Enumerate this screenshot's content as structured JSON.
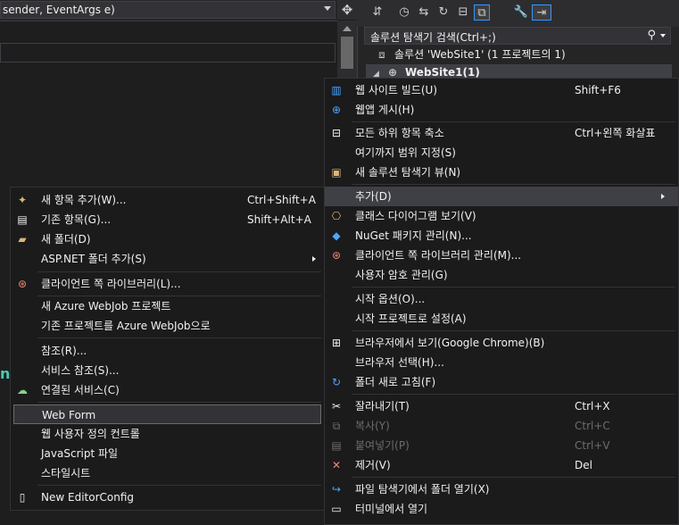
{
  "editor": {
    "method_combo": "sender, EventArgs e)",
    "split_icon": "✥",
    "code_fragment": "n"
  },
  "solution_explorer": {
    "search_placeholder": "솔루션 탐색기 검색(Ctrl+;)",
    "solution_label": "솔루션 'WebSite1' (1 프로젝트의 1)",
    "project_label": "WebSite1(1)"
  },
  "context_menu": {
    "items": [
      {
        "label": "웹 사이트 빌드(U)",
        "shortcut": "Shift+F6",
        "icon": "build-icon"
      },
      {
        "label": "웹앱 게시(H)",
        "shortcut": "",
        "icon": "publish-globe-icon"
      },
      {
        "label": "모든 하위 항목 축소",
        "shortcut": "Ctrl+왼쪽 화살표",
        "icon": "collapse-icon"
      },
      {
        "label": "여기까지 범위 지정(S)",
        "shortcut": "",
        "icon": ""
      },
      {
        "label": "새 솔루션 탐색기 뷰(N)",
        "shortcut": "",
        "icon": "new-view-icon"
      },
      {
        "label": "추가(D)",
        "shortcut": "",
        "icon": "",
        "submenu": true
      },
      {
        "label": "클래스 다이어그램 보기(V)",
        "shortcut": "",
        "icon": "class-diagram-icon"
      },
      {
        "label": "NuGet 패키지 관리(N)...",
        "shortcut": "",
        "icon": "nuget-icon"
      },
      {
        "label": "클라이언트 쪽 라이브러리 관리(M)...",
        "shortcut": "",
        "icon": "library-icon"
      },
      {
        "label": "사용자 암호 관리(G)",
        "shortcut": "",
        "icon": ""
      },
      {
        "label": "시작 옵션(O)...",
        "shortcut": "",
        "icon": ""
      },
      {
        "label": "시작 프로젝트로 설정(A)",
        "shortcut": "",
        "icon": ""
      },
      {
        "label": "브라우저에서 보기(Google Chrome)(B)",
        "shortcut": "",
        "icon": "browser-icon"
      },
      {
        "label": "브라우저 선택(H)...",
        "shortcut": "",
        "icon": ""
      },
      {
        "label": "폴더 새로 고침(F)",
        "shortcut": "",
        "icon": "refresh-icon"
      },
      {
        "label": "잘라내기(T)",
        "shortcut": "Ctrl+X",
        "icon": "cut-icon"
      },
      {
        "label": "복사(Y)",
        "shortcut": "Ctrl+C",
        "icon": "copy-icon"
      },
      {
        "label": "붙여넣기(P)",
        "shortcut": "Ctrl+V",
        "icon": "paste-icon"
      },
      {
        "label": "제거(V)",
        "shortcut": "Del",
        "icon": "remove-icon"
      },
      {
        "label": "파일 탐색기에서 폴더 열기(X)",
        "shortcut": "",
        "icon": "open-folder-icon"
      },
      {
        "label": "터미널에서 열기",
        "shortcut": "",
        "icon": "terminal-icon"
      }
    ]
  },
  "add_submenu": {
    "items": [
      {
        "label": "새 항목 추가(W)...",
        "shortcut": "Ctrl+Shift+A",
        "icon": "new-item-icon"
      },
      {
        "label": "기존 항목(G)...",
        "shortcut": "Shift+Alt+A",
        "icon": "existing-item-icon"
      },
      {
        "label": "새 폴더(D)",
        "shortcut": "",
        "icon": "new-folder-icon"
      },
      {
        "label": "ASP.NET 폴더 추가(S)",
        "shortcut": "",
        "icon": "",
        "submenu": true
      },
      {
        "label": "클라이언트 쪽 라이브러리(L)...",
        "shortcut": "",
        "icon": "library-icon"
      },
      {
        "label": "새 Azure WebJob 프로젝트",
        "shortcut": "",
        "icon": ""
      },
      {
        "label": "기존 프로젝트를 Azure WebJob으로",
        "shortcut": "",
        "icon": ""
      },
      {
        "label": "참조(R)...",
        "shortcut": "",
        "icon": ""
      },
      {
        "label": "서비스 참조(S)...",
        "shortcut": "",
        "icon": ""
      },
      {
        "label": "연결된 서비스(C)",
        "shortcut": "",
        "icon": "connected-service-icon"
      },
      {
        "label": "Web Form",
        "shortcut": "",
        "icon": ""
      },
      {
        "label": "웹 사용자 정의 컨트롤",
        "shortcut": "",
        "icon": ""
      },
      {
        "label": "JavaScript 파일",
        "shortcut": "",
        "icon": ""
      },
      {
        "label": "스타일시트",
        "shortcut": "",
        "icon": ""
      },
      {
        "label": "New EditorConfig",
        "shortcut": "",
        "icon": "editorconfig-icon"
      }
    ]
  }
}
